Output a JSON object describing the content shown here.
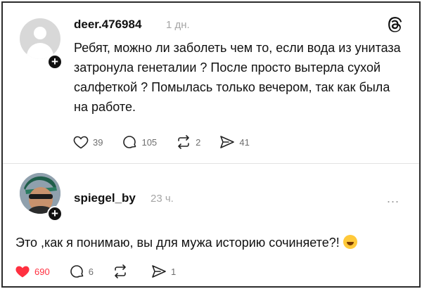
{
  "post1": {
    "username": "deer.476984",
    "time": "1 дн.",
    "text": "Ребят, можно ли заболеть чем то, если вода из унитаза затронула генеталии ? После просто вытерла сухой салфеткой ? Помылась только вечером, так как была на работе.",
    "likes": "39",
    "comments": "105",
    "reposts": "2",
    "shares": "41"
  },
  "post2": {
    "username": "spiegel_by",
    "time": "23 ч.",
    "text": "Это ,как я понимаю, вы для мужа историю сочиняете?!",
    "likes": "690",
    "comments": "6",
    "reposts": "",
    "shares": "1",
    "more": "..."
  },
  "colors": {
    "like_active": "#ff3040",
    "icon": "#222222"
  },
  "icons": [
    "heart-icon",
    "comment-icon",
    "repost-icon",
    "share-icon",
    "threads-logo-icon",
    "plus-icon",
    "laughing-emoji-icon"
  ]
}
